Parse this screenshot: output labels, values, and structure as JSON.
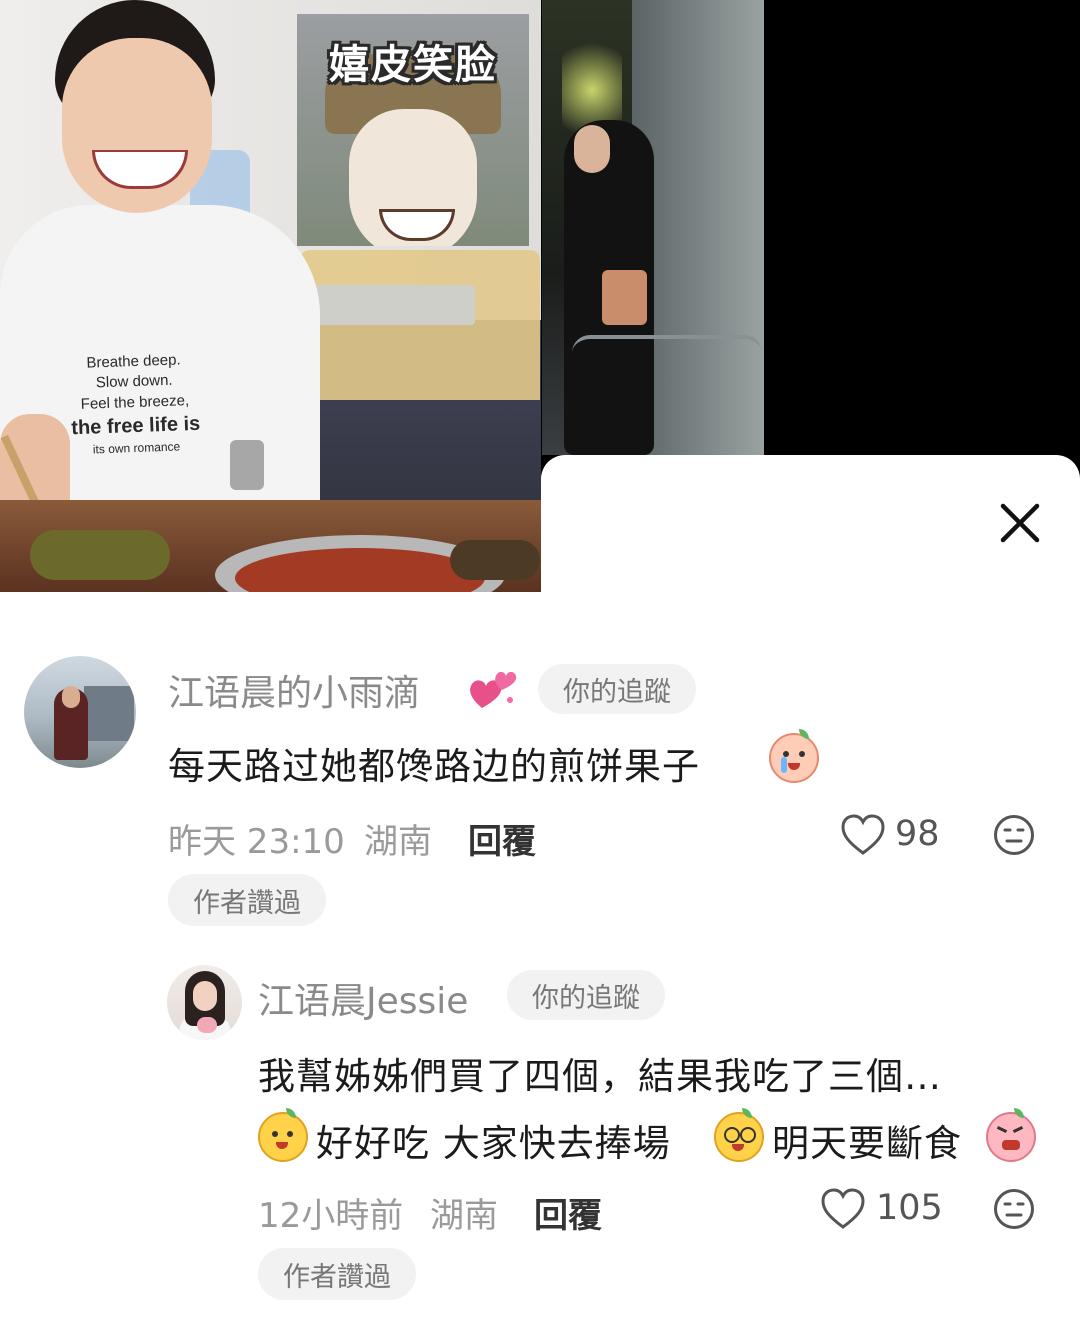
{
  "collage": {
    "meme_caption": "嬉皮笑脸",
    "shirt_lines": [
      "Breathe deep.",
      "Slow down.",
      "Feel the breeze,",
      "the free life is",
      "its own romance"
    ]
  },
  "comments": [
    {
      "username": "江语晨的小雨滴",
      "badge": "你的追蹤",
      "text": "每天路过她都馋路边的煎饼果子",
      "time": "昨天 23:10",
      "location": "湖南",
      "reply_label": "回覆",
      "likes": "98",
      "author_liked": "作者讚過"
    },
    {
      "username": "江语晨Jessie",
      "badge": "你的追蹤",
      "text_line1": "我幫姊姊們買了四個，結果我吃了三個…",
      "text_line2_a": "好好吃 大家快去捧場",
      "text_line2_b": "明天要斷食",
      "time": "12小時前",
      "location": "湖南",
      "reply_label": "回覆",
      "likes": "105",
      "author_liked": "作者讚過"
    }
  ],
  "colors": {
    "sheet_bg": "#ffffff",
    "username": "#8a8a8a",
    "comment_text": "#1b1b1b",
    "meta": "#9a9a9a",
    "tag_bg": "#f2f2f2",
    "emoji_heart": "#e8508c"
  },
  "icons": [
    "close-icon",
    "heart-outline-icon",
    "neutral-face-icon",
    "sparkle-hearts-emoji",
    "crying-emoji",
    "smiling-emoji",
    "dizzy-emoji",
    "angry-emoji"
  ]
}
